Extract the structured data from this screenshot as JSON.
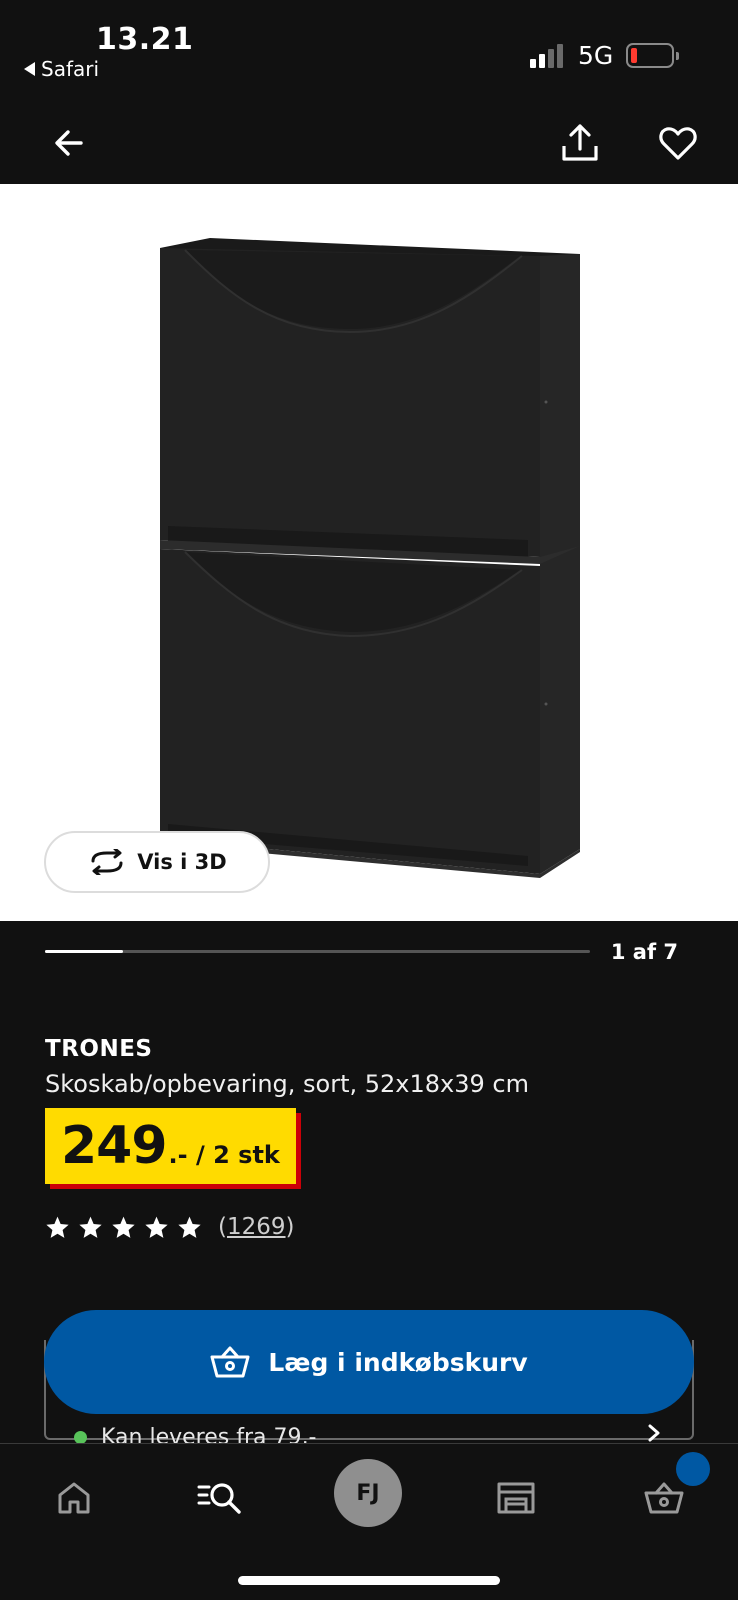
{
  "status_bar": {
    "time": "13.21",
    "back_app": "Safari",
    "network": "5G",
    "signal_bars": 2,
    "battery_level": "low",
    "battery_color": "#ff3b30"
  },
  "nav": {
    "back_icon": "arrow-left-icon",
    "share_icon": "share-icon",
    "favorite_icon": "heart-icon"
  },
  "gallery": {
    "view_3d_label": "Vis i 3D",
    "counter": "1 af 7",
    "current": 1,
    "total": 7
  },
  "product": {
    "name": "TRONES",
    "description": "Skoskab/opbevaring, sort, 52x18x39 cm",
    "price_main": "249",
    "price_suffix": ".- / 2 stk",
    "price_bg": "#ffdb00",
    "price_shadow": "#cc0008",
    "rating_stars": 5,
    "review_count": "1269"
  },
  "delivery": {
    "text": "Kan leveres fra 79,-"
  },
  "cta": {
    "add_to_cart_label": "Læg i indkøbskurv",
    "color": "#0058a3"
  },
  "tab_bar": {
    "profile_initials": "FJ",
    "tabs": [
      "home-icon",
      "search-icon",
      "profile-avatar",
      "store-icon",
      "cart-icon"
    ]
  }
}
